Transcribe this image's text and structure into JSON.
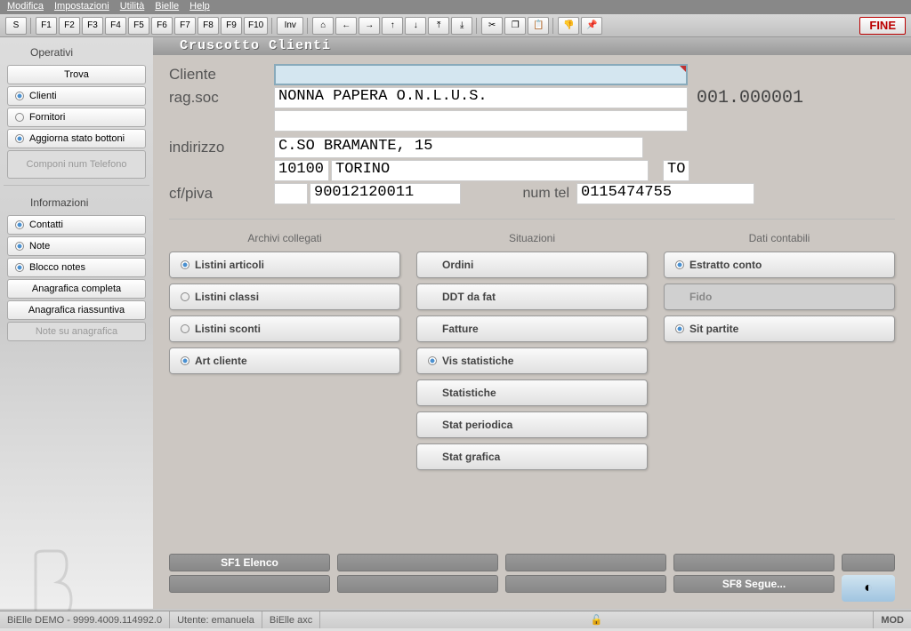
{
  "menu": {
    "items": [
      "Modifica",
      "Impostazioni",
      "Utilità",
      "Bielle",
      "Help"
    ]
  },
  "toolbar": {
    "s": "S",
    "fkeys": [
      "F1",
      "F2",
      "F3",
      "F4",
      "F5",
      "F6",
      "F7",
      "F8",
      "F9",
      "F10"
    ],
    "inv": "Inv",
    "fine": "FINE"
  },
  "sidebar": {
    "group1": {
      "title": "Operativi",
      "items": [
        {
          "label": "Trova",
          "center": true
        },
        {
          "label": "Clienti",
          "radio": true,
          "on": true
        },
        {
          "label": "Fornitori",
          "radio": true,
          "on": false
        },
        {
          "label": "Aggiorna stato bottoni",
          "radio": true,
          "on": true
        },
        {
          "label": "Componi num Telefono",
          "disabled": true,
          "center": true
        }
      ]
    },
    "group2": {
      "title": "Informazioni",
      "items": [
        {
          "label": "Contatti",
          "radio": true,
          "on": true
        },
        {
          "label": "Note",
          "radio": true,
          "on": true
        },
        {
          "label": "Blocco notes",
          "radio": true,
          "on": true
        },
        {
          "label": "Anagrafica completa",
          "center": true
        },
        {
          "label": "Anagrafica riassuntiva",
          "center": true
        },
        {
          "label": "Note su anagrafica",
          "disabled": true,
          "center": true
        }
      ]
    }
  },
  "title": "Cruscotto Clienti",
  "form": {
    "cliente_lbl": "Cliente",
    "cliente_val": "",
    "ragsoc_lbl": "rag.soc",
    "ragsoc_val": "NONNA PAPERA O.N.L.U.S.",
    "code": "001.000001",
    "indirizzo_lbl": "indirizzo",
    "indirizzo_val": "C.SO BRAMANTE, 15",
    "cap": "10100",
    "citta": "TORINO",
    "prov": "TO",
    "cfpiva_lbl": "cf/piva",
    "cfpiva_val": "90012120011",
    "numtel_lbl": "num tel",
    "numtel_val": "0115474755"
  },
  "cols": {
    "archivi": {
      "title": "Archivi collegati",
      "items": [
        {
          "label": "Listini articoli",
          "on": true
        },
        {
          "label": "Listini classi",
          "on": false
        },
        {
          "label": "Listini sconti",
          "on": false
        },
        {
          "label": "Art cliente",
          "on": true
        }
      ]
    },
    "situazioni": {
      "title": "Situazioni",
      "items": [
        {
          "label": "Ordini"
        },
        {
          "label": "DDT da fat"
        },
        {
          "label": "Fatture"
        },
        {
          "label": "Vis statistiche",
          "on": true
        },
        {
          "label": "Statistiche"
        },
        {
          "label": "Stat periodica"
        },
        {
          "label": "Stat grafica"
        }
      ]
    },
    "dati": {
      "title": "Dati contabili",
      "items": [
        {
          "label": "Estratto conto",
          "on": true
        },
        {
          "label": "Fido",
          "disabled": true
        },
        {
          "label": "Sit partite",
          "on": true
        }
      ]
    }
  },
  "footer": {
    "sf1": "SF1   Elenco",
    "sf8": "SF8   Segue..."
  },
  "status": {
    "ver": "BiElle DEMO - 9999.4009.114992.0",
    "user": "Utente: emanuela",
    "ctx": "BiElle axc",
    "mod": "MOD"
  }
}
